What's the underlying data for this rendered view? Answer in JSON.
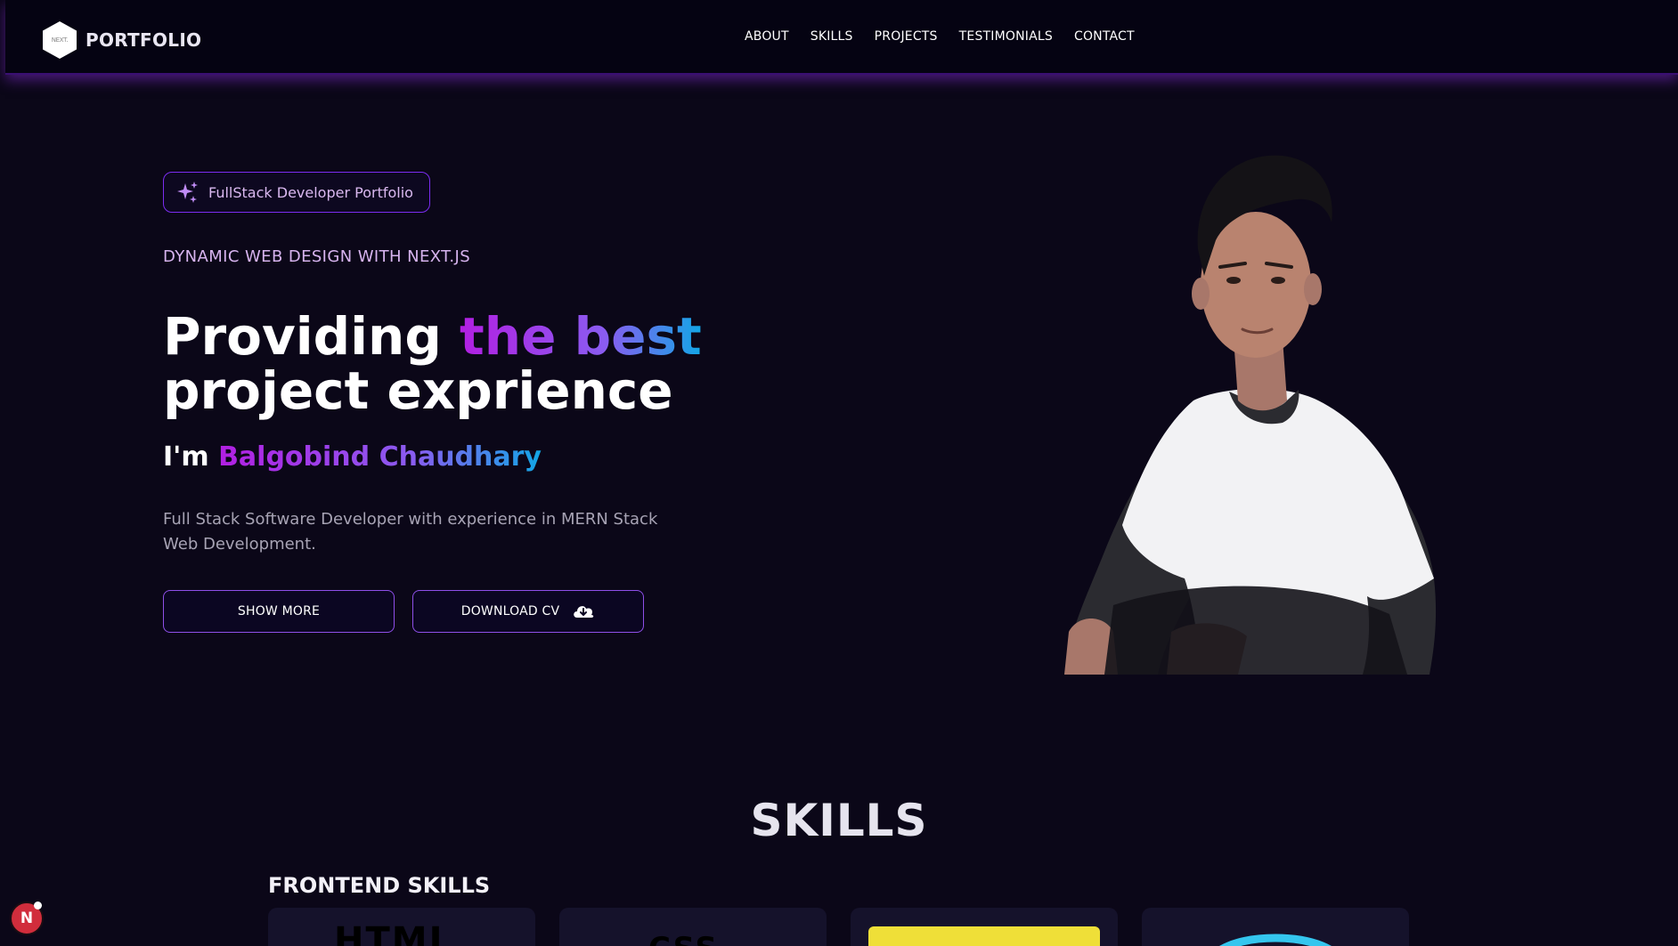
{
  "navbar": {
    "logo_text": "NEXT.",
    "brand": "PORTFOLIO",
    "links": [
      "ABOUT",
      "SKILLS",
      "PROJECTS",
      "TESTIMONIALS",
      "CONTACT"
    ]
  },
  "hero": {
    "badge": "FullStack Developer Portfolio",
    "subtitle": "DYNAMIC WEB DESIGN WITH NEXT.JS",
    "title_part1": "Providing ",
    "title_highlight": "the best",
    "title_part2": "project exprience",
    "name_prefix": "I'm ",
    "name": "Balgobind Chaudhary",
    "description": "Full Stack Software Developer with experience in MERN Stack Web Development.",
    "show_more": "SHOW MORE",
    "download_cv": "DOWNLOAD CV"
  },
  "skills": {
    "heading": "SKILLS",
    "frontend_heading": "FRONTEND SKILLS",
    "card_logos": [
      "HTML",
      "CSS"
    ]
  },
  "dev_badge": {
    "letter": "N"
  },
  "colors": {
    "background": "#0b0718",
    "accent_purple": "#b21fe2",
    "accent_blue": "#12a7e6",
    "border_purple": "#8e4fe8"
  },
  "icons": [
    "hexagon-logo-icon",
    "sparkles-icon",
    "cloud-download-icon",
    "react-atom-icon",
    "nextjs-dev-icon"
  ]
}
